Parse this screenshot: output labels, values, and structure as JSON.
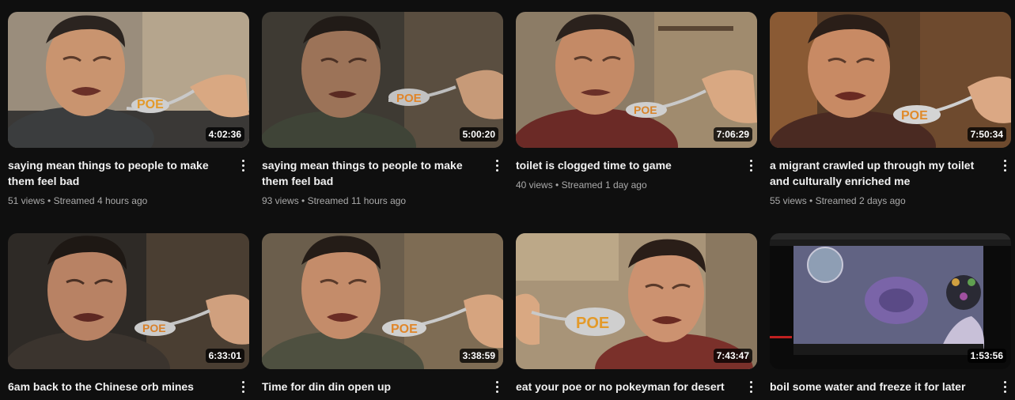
{
  "videos": [
    {
      "title": "saying mean things to people to make them feel bad",
      "views": "51 views",
      "age": "Streamed 4 hours ago",
      "duration": "4:02:36"
    },
    {
      "title": "saying mean things to people to make them feel bad",
      "views": "93 views",
      "age": "Streamed 11 hours ago",
      "duration": "5:00:20"
    },
    {
      "title": "toilet is clogged time to game",
      "views": "40 views",
      "age": "Streamed 1 day ago",
      "duration": "7:06:29"
    },
    {
      "title": "a migrant crawled up through my toilet and culturally enriched me",
      "views": "55 views",
      "age": "Streamed 2 days ago",
      "duration": "7:50:34"
    },
    {
      "title": "6am back to the Chinese orb mines",
      "views": "",
      "age": "",
      "duration": "6:33:01"
    },
    {
      "title": "Time for din din open up",
      "views": "",
      "age": "",
      "duration": "3:38:59"
    },
    {
      "title": "eat your poe or no pokeyman for desert",
      "views": "",
      "age": "",
      "duration": "7:43:47"
    },
    {
      "title": "boil some water and freeze it for later",
      "views": "",
      "age": "",
      "duration": "1:53:56"
    }
  ],
  "separator": "•",
  "spoon_text": "POE",
  "icons": {
    "more": "more-vert-icon"
  },
  "colors": {
    "background": "#0f0f0f",
    "title": "#f1f1f1",
    "meta": "#aaaaaa"
  }
}
